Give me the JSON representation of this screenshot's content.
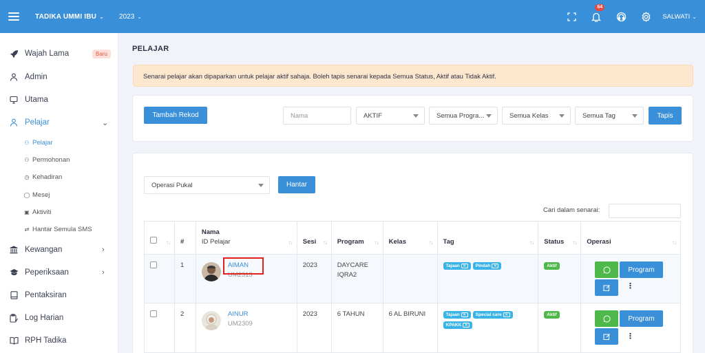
{
  "topbar": {
    "brand": "TADIKA UMMI IBU",
    "year": "2023",
    "notification_count": "64",
    "user": "SALWATI"
  },
  "sidebar": {
    "items": [
      {
        "label": "Wajah Lama",
        "icon": "rocket-icon",
        "badge": "Baru"
      },
      {
        "label": "Admin",
        "icon": "user-icon"
      },
      {
        "label": "Utama",
        "icon": "monitor-icon"
      },
      {
        "label": "Pelajar",
        "icon": "user-icon"
      },
      {
        "label": "Kewangan",
        "icon": "bank-icon"
      },
      {
        "label": "Peperiksaan",
        "icon": "graduation-cap-icon"
      },
      {
        "label": "Pentaksiran",
        "icon": "tablet-icon"
      },
      {
        "label": "Log Harian",
        "icon": "clipboard-icon"
      },
      {
        "label": "RPH Tadika",
        "icon": "book-icon"
      }
    ],
    "sub_items": [
      {
        "label": "Pelajar"
      },
      {
        "label": "Permohonan"
      },
      {
        "label": "Kehadiran"
      },
      {
        "label": "Mesej"
      },
      {
        "label": "Aktiviti"
      },
      {
        "label": "Hantar Semula SMS"
      }
    ]
  },
  "main": {
    "title": "PELAJAR",
    "alert": "Senarai pelajar akan dipaparkan untuk pelajar aktif sahaja. Boleh tapis senarai kepada Semua Status, Aktif atau Tidak Aktif.",
    "filters": {
      "add_button": "Tambah Rekod",
      "name_placeholder": "Nama",
      "status": "AKTIF",
      "program": "Semua Progra...",
      "class": "Semua Kelas",
      "tag": "Semua Tag",
      "filter_button": "Tapis"
    },
    "bulk": {
      "operation": "Operasi Pukal",
      "send_button": "Hantar",
      "search_label": "Cari dalam senarai:"
    },
    "table": {
      "headers": {
        "no": "#",
        "name": "Nama",
        "student_id": "ID Pelajar",
        "session": "Sesi",
        "program": "Program",
        "class": "Kelas",
        "tag": "Tag",
        "status": "Status",
        "operation": "Operasi"
      },
      "rows": [
        {
          "no": "1",
          "name": "AIMAN",
          "id": "UM2313",
          "session": "2023",
          "program_line1": "DAYCARE",
          "program_line2": "IQRA2",
          "class": "",
          "tags": [
            "Tajaan",
            "Pindah"
          ],
          "status": "Aktif",
          "program_button": "Program"
        },
        {
          "no": "2",
          "name": "AINUR",
          "id": "UM2309",
          "session": "2023",
          "program_line1": "6 TAHUN",
          "program_line2": "",
          "class": "6 AL BIRUNI",
          "tags": [
            "Tajaan",
            "Special care",
            "KPAKK"
          ],
          "status": "Aktif",
          "program_button": "Program"
        }
      ]
    }
  }
}
